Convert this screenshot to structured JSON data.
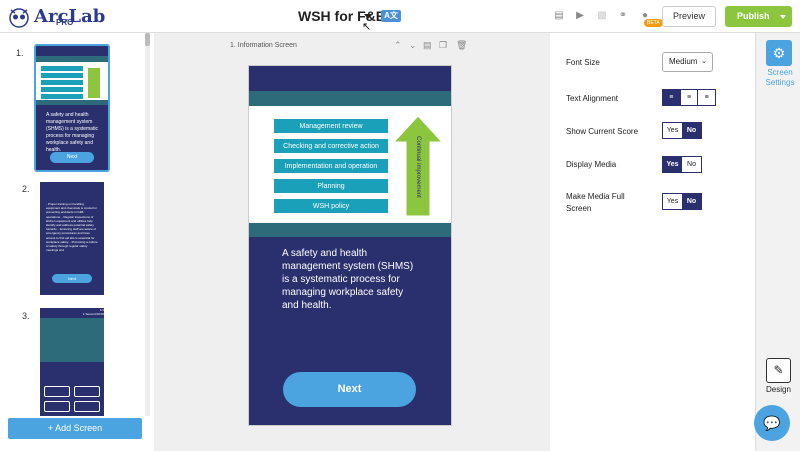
{
  "header": {
    "brand": "ArcLab",
    "brand_tier": "PRO",
    "title": "WSH for F&B",
    "lang_badge": "A文",
    "beta_badge": "BETA",
    "preview_label": "Preview",
    "publish_label": "Publish"
  },
  "slides": {
    "numbers": [
      "1.",
      "2.",
      "3."
    ],
    "add_label": "+ Add Screen",
    "thumb1_text": "A safety and health management system (SHMS) is a systematic process for managing workplace safety and health.",
    "thumb1_button": "Next",
    "thumb2_text": "- Proper training on handling equipment and chemicals is crucial for preventing accidents in F&B operations. - Regular inspections of kitchen equipment and utilities help identify and address potential safety hazards. - Ensuring staff are aware of emergency procedures and have access to first aid kits is essential for workplace safety. - Promoting a culture of safety through regular safety meetings and",
    "thumb2_button": "Next",
    "thumb3_header": "1/1\n1 Second 00:00"
  },
  "canvas": {
    "screen_label": "1.    Information Screen",
    "media_items": [
      "Management review",
      "Checking and corrective action",
      "Implementation and operation",
      "Planning",
      "WSH policy"
    ],
    "arrow_label": "Continual improvement",
    "body_text": "A safety and health management system (SHMS) is a systematic process for managing workplace safety and health.",
    "next_label": "Next"
  },
  "settings": {
    "font_size_label": "Font Size",
    "font_size_value": "Medium",
    "text_alignment_label": "Text Alignment",
    "show_score_label": "Show Current Score",
    "display_media_label": "Display Media",
    "full_screen_label": "Make Media Full Screen",
    "yes": "Yes",
    "no": "No"
  },
  "sidebar": {
    "screen_settings_label": "Screen Settings",
    "design_label": "Design"
  },
  "colors": {
    "accent": "#4ba3e0",
    "navy": "#2a2f6e",
    "publish_green": "#8cc63f",
    "arrow_green": "#8cc63f",
    "teal": "#1aa0b8"
  }
}
